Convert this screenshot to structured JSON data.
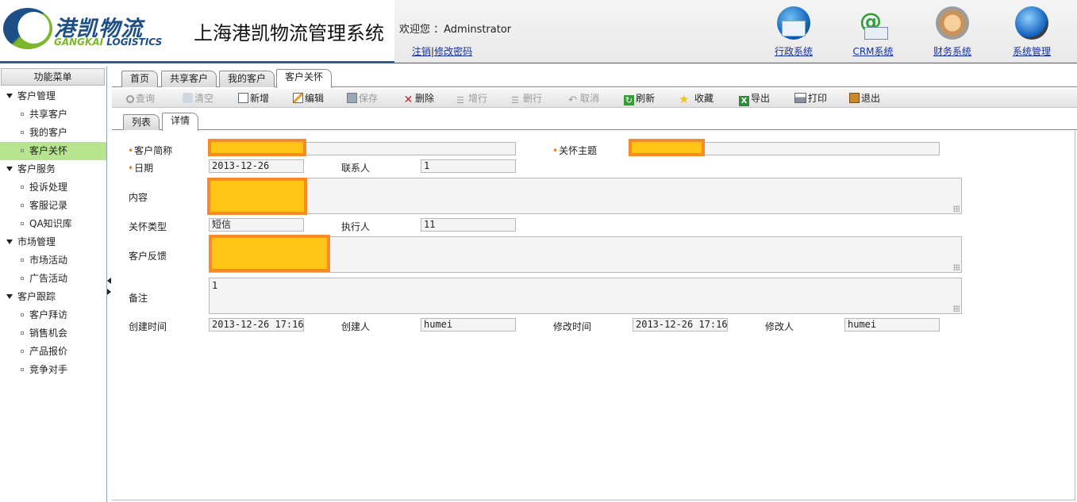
{
  "logo": {
    "cn": "港凯物流",
    "en_a": "GANGKAI",
    "en_b": " LOGISTICS"
  },
  "system_title": "上海港凯物流管理系统",
  "welcome": {
    "text": "欢迎您 ：Adminstrator",
    "logout": "注销",
    "change_password": "修改密码"
  },
  "systems": [
    {
      "label": "行政系统",
      "icon": "mail-globe-icon"
    },
    {
      "label": "CRM系统",
      "icon": "email-at-icon"
    },
    {
      "label": "财务系统",
      "icon": "finance-icon"
    },
    {
      "label": "系统管理",
      "icon": "globe-gear-icon"
    }
  ],
  "sidebar": {
    "title": "功能菜单",
    "groups": [
      {
        "label": "客户管理",
        "items": [
          "共享客户",
          "我的客户",
          "客户关怀"
        ]
      },
      {
        "label": "客户服务",
        "items": [
          "投诉处理",
          "客服记录",
          "QA知识库"
        ]
      },
      {
        "label": "市场管理",
        "items": [
          "市场活动",
          "广告活动"
        ]
      },
      {
        "label": "客户跟踪",
        "items": [
          "客户拜访",
          "销售机会",
          "产品报价",
          "竞争对手"
        ]
      }
    ],
    "active_item": "客户关怀"
  },
  "tabs": [
    "首页",
    "共享客户",
    "我的客户",
    "客户关怀"
  ],
  "active_tab": "客户关怀",
  "toolbar": {
    "query": "查询",
    "clear": "清空",
    "add": "新增",
    "edit": "编辑",
    "save": "保存",
    "delete": "删除",
    "add_row": "增行",
    "del_row": "删行",
    "cancel": "取消",
    "refresh": "刷新",
    "favorite": "收藏",
    "export": "导出",
    "print": "打印",
    "exit": "退出"
  },
  "subtabs": [
    "列表",
    "详情"
  ],
  "active_subtab": "详情",
  "form": {
    "customer_short": {
      "label": "客户简称",
      "value": ""
    },
    "care_subject": {
      "label": "关怀主题",
      "value": ""
    },
    "date": {
      "label": "日期",
      "value": "2013-12-26"
    },
    "contact": {
      "label": "联系人",
      "value": "1"
    },
    "content": {
      "label": "内容",
      "value": ""
    },
    "care_type": {
      "label": "关怀类型",
      "value": "短信"
    },
    "executor": {
      "label": "执行人",
      "value": "11"
    },
    "feedback": {
      "label": "客户反馈",
      "value": ""
    },
    "remark": {
      "label": "备注",
      "value": "1"
    },
    "created_time": {
      "label": "创建时间",
      "value": "2013-12-26 17:16"
    },
    "creator": {
      "label": "创建人",
      "value": "humei"
    },
    "modified_time": {
      "label": "修改时间",
      "value": "2013-12-26 17:16"
    },
    "modifier": {
      "label": "修改人",
      "value": "humei"
    }
  },
  "colors": {
    "accent_border": "#2b5f8e",
    "active_menu": "#b7e48f",
    "required_marker": "#f07a1a",
    "redaction_fill": "#ffc414",
    "redaction_border": "#f58a26"
  }
}
